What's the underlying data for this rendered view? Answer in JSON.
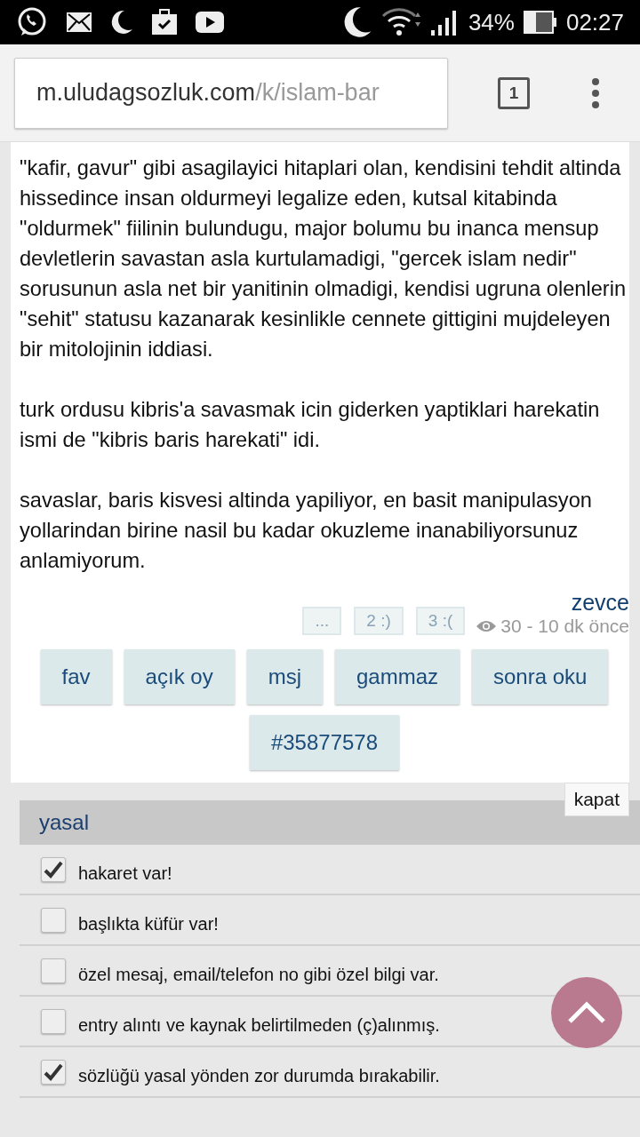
{
  "status_bar": {
    "battery": "34%",
    "time": "02:27"
  },
  "browser": {
    "url_host": "m.uludagsozluk.com",
    "url_path": "/k/islam-bar",
    "tab_count": "1"
  },
  "entry": {
    "paragraphs": [
      "\"kafir, gavur\" gibi asagilayici hitaplari olan, kendisini tehdit altinda hissedince insan oldurmeyi legalize eden, kutsal kitabinda \"oldurmek\" fiilinin bulundugu, major bolumu bu inanca mensup devletlerin savastan asla kurtulamadigi, \"gercek islam nedir\" sorusunun asla net bir yanitinin olmadigi, kendisi ugruna olenlerin \"sehit\" statusu kazanarak kesinlikle cennete gittigini mujdeleyen bir mitolojinin iddiasi.",
      "turk ordusu kibris'a savasmak icin giderken yaptiklari harekatin ismi de \"kibris baris harekati\" idi.",
      "savaslar, baris kisvesi altinda yapiliyor, en basit manipulasyon yollarindan birine nasil bu kadar okuzleme inanabiliyorsunuz anlamiyorum."
    ],
    "votes": [
      "...",
      "2 :)",
      "3 :("
    ],
    "author": "zevce",
    "stats": "30 - 10 dk önce"
  },
  "actions": [
    "fav",
    "açık oy",
    "msj",
    "gammaz",
    "sonra oku"
  ],
  "entry_id": "#35877578",
  "report": {
    "close": "kapat",
    "section": "yasal",
    "options": [
      {
        "label": "hakaret var!",
        "checked": true
      },
      {
        "label": "başlıkta küfür var!",
        "checked": false
      },
      {
        "label": "özel mesaj, email/telefon no gibi özel bilgi var.",
        "checked": false
      },
      {
        "label": "entry alıntı ve kaynak belirtilmeden (ç)alınmış.",
        "checked": false
      },
      {
        "label": "sözlüğü yasal yönden zor durumda bırakabilir.",
        "checked": true
      }
    ]
  }
}
